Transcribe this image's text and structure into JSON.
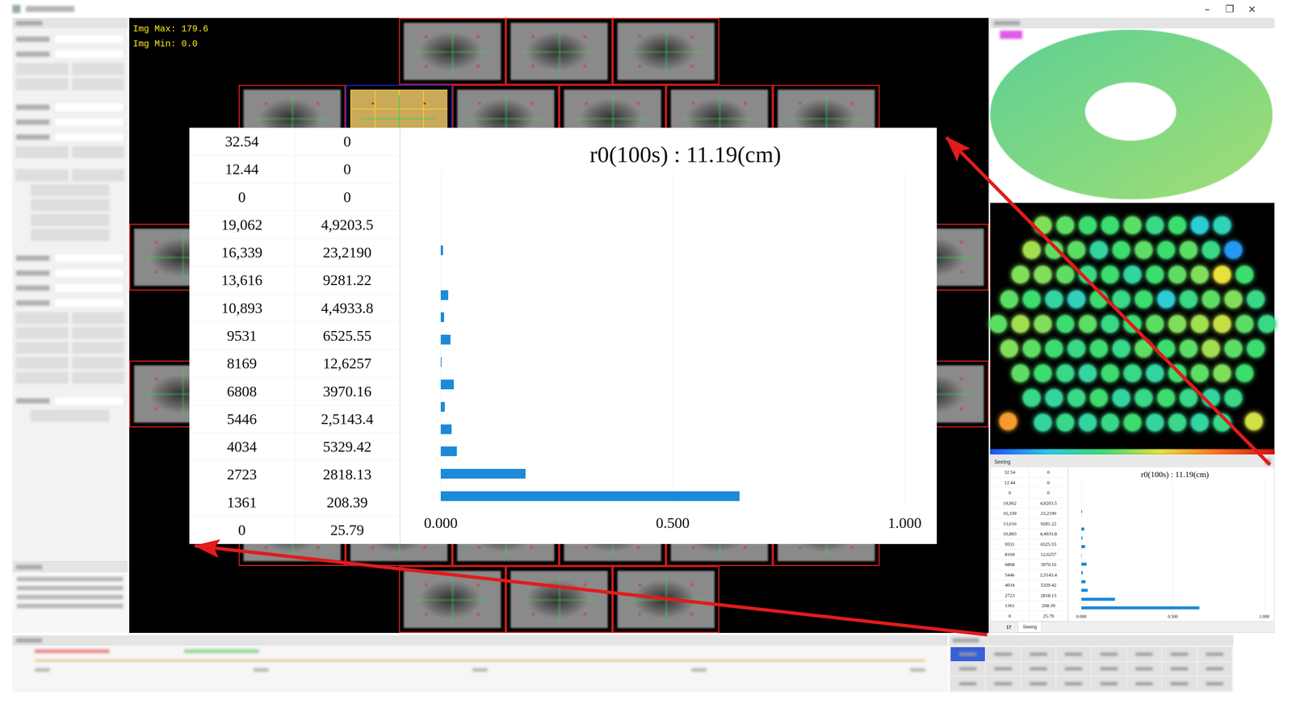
{
  "window": {
    "controls": [
      "–",
      "❐",
      "×"
    ]
  },
  "image": {
    "max_label": "Img Max: 179.6",
    "min_label": "Img Min: 0.0",
    "upper_rows": [
      {
        "tiles": [
          {
            "selected": false
          },
          {
            "selected": false
          },
          {
            "selected": false
          }
        ]
      },
      {
        "tiles": [
          {
            "selected": false
          },
          {
            "selected": true
          },
          {
            "selected": false
          },
          {
            "selected": false
          },
          {
            "selected": false
          },
          {
            "selected": false
          }
        ]
      }
    ],
    "side_rows": [
      {
        "tiles": [
          {
            "selected": false
          },
          {
            "selected": false
          }
        ]
      },
      {
        "tiles": [
          {
            "selected": false
          },
          {
            "selected": false
          }
        ]
      }
    ],
    "lower_rows": [
      {
        "tiles": [
          {
            "selected": false
          },
          {
            "selected": false
          },
          {
            "selected": false
          },
          {
            "selected": false
          },
          {
            "selected": false
          },
          {
            "selected": false
          }
        ]
      },
      {
        "tiles": [
          {
            "selected": false
          },
          {
            "selected": false
          },
          {
            "selected": false
          }
        ]
      }
    ]
  },
  "wavefront_spots": {
    "rows": [
      [
        0.6,
        0.55,
        0.5,
        0.5,
        0.55,
        0.45,
        0.5,
        0.3,
        0.35
      ],
      [
        0.65,
        0.55,
        0.55,
        0.4,
        0.5,
        0.55,
        0.5,
        0.55,
        0.45,
        0.15
      ],
      [
        0.6,
        0.6,
        0.55,
        0.45,
        0.5,
        0.4,
        0.5,
        0.55,
        0.6,
        0.75,
        0.5
      ],
      [
        0.55,
        0.5,
        0.4,
        0.35,
        0.5,
        0.45,
        0.5,
        0.3,
        0.45,
        0.55,
        0.6,
        0.45
      ],
      [
        0.55,
        0.65,
        0.6,
        0.5,
        0.55,
        0.45,
        0.5,
        0.55,
        0.6,
        0.65,
        0.7,
        0.55,
        0.45
      ],
      [
        0.6,
        0.55,
        0.5,
        0.45,
        0.5,
        0.45,
        0.55,
        0.5,
        0.55,
        0.65,
        0.55,
        0.5
      ],
      [
        0.55,
        0.5,
        0.45,
        0.4,
        0.5,
        0.45,
        0.4,
        0.5,
        0.55,
        0.6,
        0.5
      ],
      [
        0.45,
        0.4,
        0.45,
        0.5,
        0.4,
        0.45,
        0.5,
        0.45,
        0.4,
        0.45
      ],
      [
        0.4,
        0.45,
        0.4,
        0.45,
        0.5,
        0.4,
        0.45,
        0.4,
        0.45
      ]
    ],
    "outliers": [
      0.9,
      0.72
    ]
  },
  "seeing": {
    "panel_title": "Seeing",
    "title": "r0(100s) : 11.19(cm)",
    "table": [
      [
        "32.54",
        "0"
      ],
      [
        "12.44",
        "0"
      ],
      [
        "0",
        "0"
      ],
      [
        "19,062",
        "4,9203.5"
      ],
      [
        "16,339",
        "23,2190"
      ],
      [
        "13,616",
        "9281.22"
      ],
      [
        "10,893",
        "4,4933.8"
      ],
      [
        "9531",
        "6525.55"
      ],
      [
        "8169",
        "12,6257"
      ],
      [
        "6808",
        "3970.16"
      ],
      [
        "5446",
        "2,5143.4"
      ],
      [
        "4034",
        "5329.42"
      ],
      [
        "2723",
        "2818.13"
      ],
      [
        "1361",
        "208.39"
      ],
      [
        "0",
        "25.79"
      ]
    ],
    "bars": [
      0,
      0,
      0,
      0.005,
      0,
      0.016,
      0.007,
      0.021,
      0.002,
      0.028,
      0.009,
      0.023,
      0.035,
      0.183,
      0.644
    ],
    "ticks": [
      "0.000",
      "0.500",
      "1.000"
    ],
    "tabs": [
      {
        "label": "17",
        "selected": false
      },
      {
        "label": "Seeing",
        "selected": true
      }
    ]
  }
}
